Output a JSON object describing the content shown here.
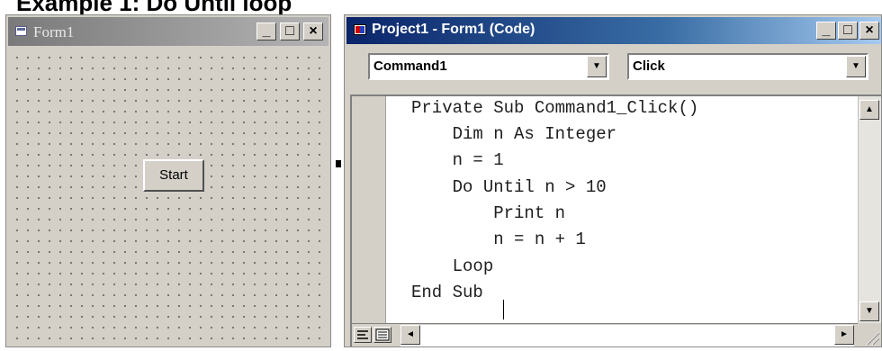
{
  "page_heading": "Example 1: Do Until loop",
  "form_window": {
    "title": "Form1",
    "minimize_label": "_",
    "maximize_label": "□",
    "close_label": "×",
    "start_button_label": "Start"
  },
  "code_window": {
    "title": "Project1 - Form1 (Code)",
    "minimize_label": "_",
    "maximize_label": "□",
    "close_label": "×",
    "object_combo": {
      "value": "Command1",
      "arrow": "▼"
    },
    "procedure_combo": {
      "value": "Click",
      "arrow": "▼"
    },
    "code_lines": [
      "Private Sub Command1_Click()",
      "    Dim n As Integer",
      "    n = 1",
      "    Do Until n > 10",
      "        Print n",
      "        n = n + 1",
      "    Loop",
      "End Sub"
    ],
    "scroll_up": "▲",
    "scroll_down": "▼",
    "scroll_left": "◄",
    "scroll_right": "►"
  },
  "icons": {
    "form_system_icon": "form-icon",
    "code_system_icon": "vb-project-icon",
    "procedure_view": "procedure-view-icon",
    "full_module_view": "full-module-view-icon"
  },
  "colors": {
    "active_title_start": "#0a246a",
    "active_title_end": "#a6caf0",
    "inactive_title": "#7a7a7a",
    "face": "#d4d0c8"
  }
}
